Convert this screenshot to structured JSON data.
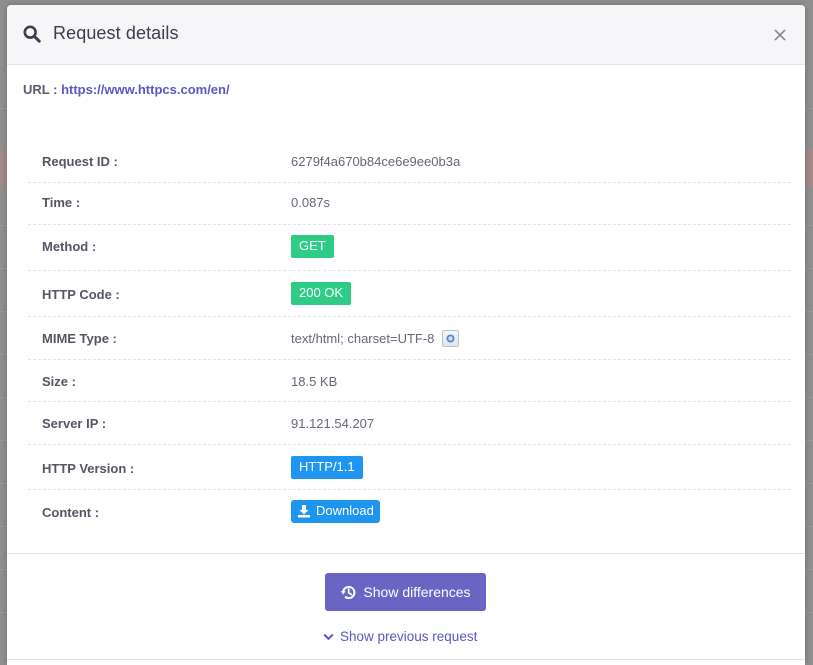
{
  "modal": {
    "title": "Request details",
    "title_icon": "search-icon",
    "close_icon": "close-icon"
  },
  "url": {
    "label": "URL :",
    "value": "https://www.httpcs.com/en/"
  },
  "details": {
    "request_id": {
      "label": "Request ID :",
      "value": "6279f4a670b84ce6e9ee0b3a"
    },
    "time": {
      "label": "Time :",
      "value": "0.087s"
    },
    "method": {
      "label": "Method :",
      "value": "GET"
    },
    "http_code": {
      "label": "HTTP Code :",
      "value": "200 OK"
    },
    "mime_type": {
      "label": "MIME Type :",
      "value": "text/html; charset=UTF-8"
    },
    "size": {
      "label": "Size :",
      "value": "18.5 KB"
    },
    "server_ip": {
      "label": "Server IP :",
      "value": "91.121.54.207"
    },
    "http_version": {
      "label": "HTTP Version :",
      "value": "HTTP/1.1"
    },
    "content": {
      "label": "Content :",
      "value": "Download"
    }
  },
  "footer": {
    "show_differences": "Show differences",
    "show_previous": "Show previous request"
  },
  "colors": {
    "accent": "#6a64c4",
    "link": "#5c57c2",
    "success": "#2ecc85",
    "info": "#1e96f0"
  }
}
